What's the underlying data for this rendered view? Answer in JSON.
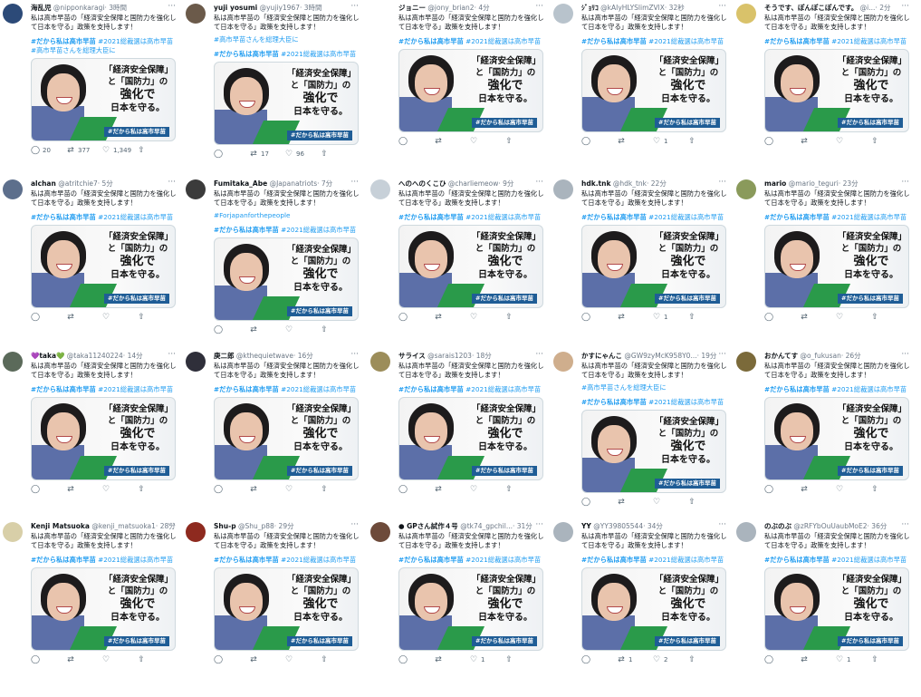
{
  "body_text": "私は高市早苗の「経済安全保障と国防力を強化して日本を守る」政策を支持します！",
  "card": {
    "line1": "「経済安全保障」",
    "line2": "と「国防力」の",
    "line3": "強化で",
    "line4": "日本を守る。",
    "caption": "#だから私は高市早苗"
  },
  "tags": {
    "hashtag_bold": "#だから私は高市早苗",
    "hashtag_rest": " #2021総裁選は高市早苗"
  },
  "colors": {
    "link": "#1d9bf0",
    "caption_bg": "#1f5d96",
    "suit_blue": "#5c6fa8",
    "accent_green": "#2a9a4a"
  },
  "icons": {
    "reply": "reply-icon",
    "retweet": "retweet-icon",
    "like": "heart-icon",
    "share": "share-icon"
  },
  "tweets": [
    {
      "name": "海乱児",
      "handle": "@nipponkaragi",
      "time": "· 3時間",
      "extra": "",
      "tags_extra": "#高市早苗さんを総理大臣に",
      "replies": "20",
      "retweets": "377",
      "likes": "1,349",
      "avatar": "#2c4a78"
    },
    {
      "name": "yuji yosumi",
      "handle": "@yujiy1967",
      "time": "· 3時間",
      "extra": "#高市早苗さんを総理大臣に",
      "tags_extra": "",
      "replies": "",
      "retweets": "17",
      "likes": "96",
      "avatar": "#6b5a4a"
    },
    {
      "name": "ジョニー",
      "handle": "@jony_brian2",
      "time": "· 4分",
      "extra": "",
      "tags_extra": "",
      "replies": "",
      "retweets": "",
      "likes": "",
      "avatar": "#ffffff"
    },
    {
      "name": "ｼﾞｮﾘｺ",
      "handle": "@kAIyHLYSlimZVlX",
      "time": "· 32秒",
      "extra": "",
      "tags_extra": "",
      "replies": "",
      "retweets": "",
      "likes": "1",
      "avatar": "#b8c3cc"
    },
    {
      "name": "そうです、ぽんぽこぽんです。",
      "handle": "@i...",
      "time": "· 2分",
      "extra": "",
      "tags_extra": "",
      "replies": "",
      "retweets": "",
      "likes": "",
      "avatar": "#d9c26a"
    },
    {
      "name": "alchan",
      "handle": "@atritchie7",
      "time": "· 5分",
      "extra": "",
      "tags_extra": "",
      "replies": "",
      "retweets": "",
      "likes": "",
      "avatar": "#5d6f8c"
    },
    {
      "name": "Fumitaka_Abe",
      "handle": "@Japanatriots",
      "time": "· 7分",
      "extra": "#Forjapanforthepeople",
      "tags_extra": "",
      "replies": "",
      "retweets": "",
      "likes": "",
      "avatar": "#3b3b3b"
    },
    {
      "name": "へのへのくこひ",
      "handle": "@charliemeow",
      "time": "· 9分",
      "extra": "",
      "tags_extra": "",
      "replies": "",
      "retweets": "",
      "likes": "",
      "avatar": "#c7d0d8"
    },
    {
      "name": "hdk.tnk",
      "handle": "@hdk_tnk",
      "time": "· 22分",
      "extra": "",
      "tags_extra": "",
      "replies": "",
      "retweets": "",
      "likes": "1",
      "avatar": "#aab4bd"
    },
    {
      "name": "mario",
      "handle": "@mario_teguri",
      "time": "· 23分",
      "extra": "",
      "tags_extra": "",
      "replies": "",
      "retweets": "",
      "likes": "",
      "avatar": "#8a9a5b"
    },
    {
      "name": "💜taka💚",
      "handle": "@taka11240224",
      "time": "· 14分",
      "extra": "",
      "tags_extra": "",
      "replies": "",
      "retweets": "",
      "likes": "",
      "avatar": "#5b6a5a"
    },
    {
      "name": "庚二郎",
      "handle": "@kthequietwave",
      "time": "· 16分",
      "extra": "",
      "tags_extra": "",
      "replies": "",
      "retweets": "",
      "likes": "",
      "avatar": "#2f2f3a"
    },
    {
      "name": "サライス",
      "handle": "@sarais1203",
      "time": "· 18分",
      "extra": "",
      "tags_extra": "",
      "replies": "",
      "retweets": "",
      "likes": "",
      "avatar": "#9c8d5a"
    },
    {
      "name": "かすにゃんこ",
      "handle": "@GW9zyMcK958Y0...",
      "time": "· 19分",
      "extra": "#高市早苗さんを総理大臣に",
      "tags_extra": "",
      "replies": "",
      "retweets": "",
      "likes": "",
      "avatar": "#cfae8d"
    },
    {
      "name": "おかんてす",
      "handle": "@o_fukusan",
      "time": "· 26分",
      "extra": "",
      "tags_extra": "",
      "replies": "",
      "retweets": "",
      "likes": "",
      "avatar": "#7b6a3a"
    },
    {
      "name": "Kenji Matsuoka",
      "handle": "@kenji_matsuoka1",
      "time": "· 28分",
      "extra": "",
      "tags_extra": "",
      "replies": "",
      "retweets": "",
      "likes": "",
      "avatar": "#d8cfa8"
    },
    {
      "name": "Shu-p",
      "handle": "@Shu_p88",
      "time": "· 29分",
      "extra": "",
      "tags_extra": "",
      "replies": "",
      "retweets": "",
      "likes": "",
      "avatar": "#8e2a1f"
    },
    {
      "name": "● GPさん試作４号",
      "handle": "@tk74_gpchil...",
      "time": "· 31分",
      "extra": "",
      "tags_extra": "",
      "replies": "",
      "retweets": "",
      "likes": "1",
      "avatar": "#6d4a3a"
    },
    {
      "name": "YY",
      "handle": "@YY39805544",
      "time": "· 34分",
      "extra": "",
      "tags_extra": "",
      "replies": "",
      "retweets": "1",
      "likes": "2",
      "avatar": "#aab4bd"
    },
    {
      "name": "のぶのぶ",
      "handle": "@zRFYbOuUaubMoE2",
      "time": "· 36分",
      "extra": "",
      "tags_extra": "",
      "replies": "",
      "retweets": "",
      "likes": "1",
      "avatar": "#aab4bd"
    }
  ]
}
